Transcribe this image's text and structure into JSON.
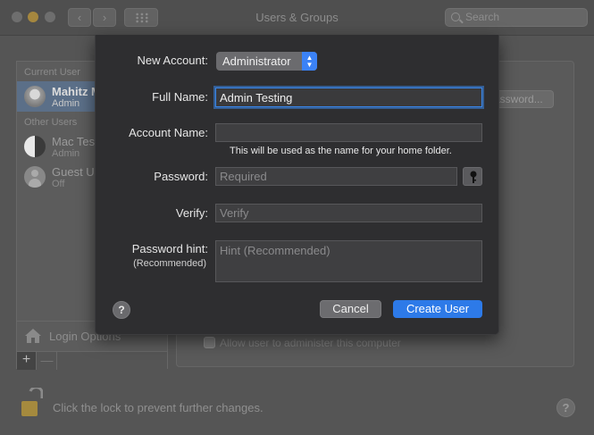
{
  "window": {
    "title": "Users & Groups",
    "search_placeholder": "Search"
  },
  "sidebar": {
    "current_user_header": "Current User",
    "other_users_header": "Other Users",
    "users": [
      {
        "name": "Mahitz M",
        "role": "Admin"
      },
      {
        "name": "Mac Test",
        "role": "Admin"
      },
      {
        "name": "Guest User",
        "role": "Off"
      }
    ],
    "login_options_label": "Login Options",
    "add_label": "+",
    "remove_label": "—"
  },
  "content": {
    "change_password_label": "Password...",
    "allow_admin_label": "Allow user to administer this computer"
  },
  "footer": {
    "lock_text": "Click the lock to prevent further changes.",
    "help_label": "?"
  },
  "sheet": {
    "new_account_label": "New Account:",
    "new_account_value": "Administrator",
    "full_name_label": "Full Name:",
    "full_name_value": "Admin Testing",
    "account_name_label": "Account Name:",
    "account_name_value": "",
    "account_name_note": "This will be used as the name for your home folder.",
    "password_label": "Password:",
    "password_placeholder": "Required",
    "verify_label": "Verify:",
    "verify_placeholder": "Verify",
    "hint_label": "Password hint:",
    "hint_sublabel": "(Recommended)",
    "hint_placeholder": "Hint (Recommended)",
    "help_label": "?",
    "cancel_label": "Cancel",
    "create_label": "Create User"
  },
  "colors": {
    "accent": "#2d7ae8",
    "focus_ring": "#3a86e8",
    "sheet_bg": "#2e2e30"
  }
}
